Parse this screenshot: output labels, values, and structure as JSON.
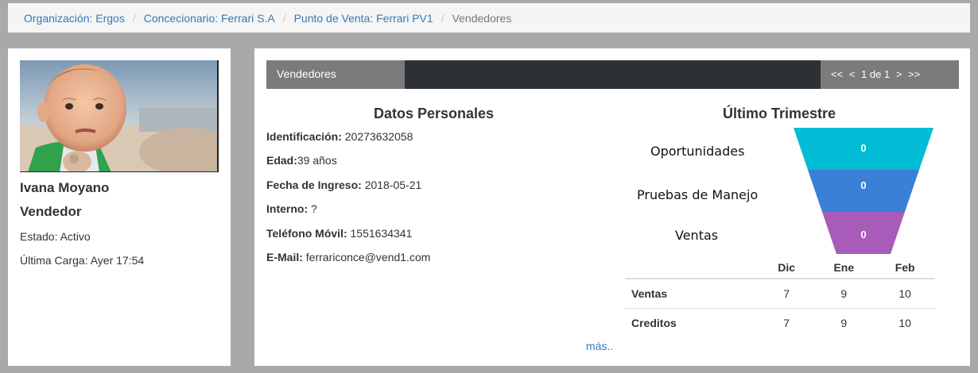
{
  "breadcrumb": {
    "items": [
      "Organización: Ergos",
      "Concecionario: Ferrari S.A",
      "Punto de Venta: Ferrari PV1"
    ],
    "current": "Vendedores",
    "separator": "/"
  },
  "profile": {
    "name": "Ivana Moyano",
    "role": "Vendedor",
    "status": "Estado: Activo",
    "last_load": "Última Carga: Ayer 17:54"
  },
  "panel": {
    "title": "Vendedores",
    "pager": {
      "first": "<<",
      "prev": "<",
      "page": "1 de 1",
      "next": ">",
      "last": ">>"
    }
  },
  "personal": {
    "title": "Datos Personales",
    "fields": [
      {
        "label": "Identificación:",
        "value": " 20273632058"
      },
      {
        "label": "Edad:",
        "value": "39 años"
      },
      {
        "label": "Fecha de Ingreso:",
        "value": " 2018-05-21"
      },
      {
        "label": "Interno:",
        "value": " ?"
      },
      {
        "label": "Teléfono Móvil:",
        "value": " 1551634341"
      },
      {
        "label": "E-Mail:",
        "value": " ferrariconce@vend1.com"
      }
    ]
  },
  "quarter": {
    "title": "Último Trimestre",
    "funnel": [
      {
        "label": "Oportunidades",
        "value": "0",
        "color": "#00bcd4"
      },
      {
        "label": "Pruebas de Manejo",
        "value": "0",
        "color": "#3a80d6"
      },
      {
        "label": "Ventas",
        "value": "0",
        "color": "#a85bb8"
      }
    ],
    "table": {
      "columns": [
        "Dic",
        "Ene",
        "Feb"
      ],
      "rows": [
        {
          "label": "Ventas",
          "values": [
            "7",
            "9",
            "10"
          ]
        },
        {
          "label": "Creditos",
          "values": [
            "7",
            "9",
            "10"
          ]
        }
      ]
    }
  },
  "more_link": "más.."
}
